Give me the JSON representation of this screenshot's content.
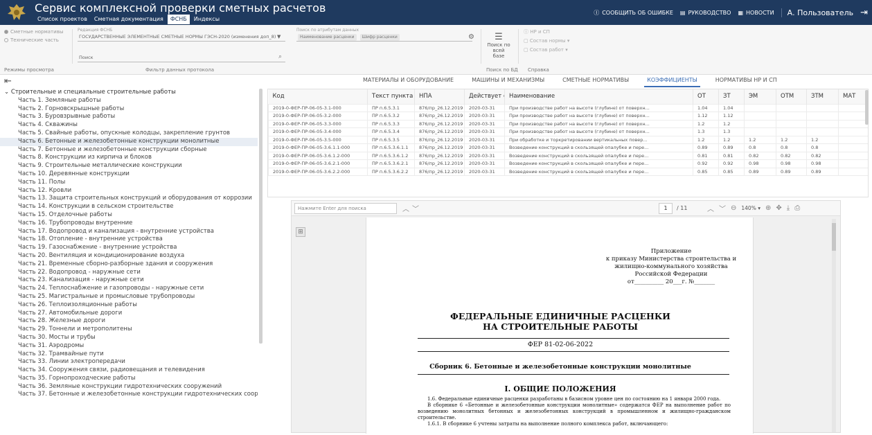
{
  "header": {
    "app_title": "Сервис комплексной проверки сметных расчетов",
    "tabs": [
      {
        "label": "Список проектов"
      },
      {
        "label": "Сметная документация"
      },
      {
        "label": "ФСНБ"
      },
      {
        "label": "Индексы"
      }
    ],
    "active_tab": "ФСНБ",
    "report_error": "Сообщить об ошибке",
    "guide": "Руководство",
    "news": "Новости",
    "user": "А. Пользователь"
  },
  "toolbar": {
    "mode_radio_1": "Сметные нормативы",
    "mode_radio_2": "Технические часть",
    "view_modes_caption": "Режимы просмотра",
    "edition_label": "Редакция ФСНБ",
    "edition_value": "ГОСУДАРСТВЕННЫЕ ЭЛЕМЕНТНЫЕ СМЕТНЫЕ НОРМЫ ГЭСН-2020 (изменения доп_8)",
    "search_placeholder": "Поиск",
    "protocol_search_label": "Поиск по атрибутам данных",
    "chip_1": "Наименование расценки",
    "chip_2": "Шифр расценки",
    "filter_caption": "Фильтр данных протокола",
    "db_search_line1": "Поиск по всей",
    "db_search_line2": "базе",
    "db_search_caption": "Поиск по БД",
    "help_item_1": "НР и СП",
    "help_item_2": "Состав нормы",
    "help_item_3": "Состав работ",
    "help_caption": "Справка"
  },
  "content_tabs": [
    {
      "label": "МАТЕРИАЛЫ И ОБОРУДОВАНИЕ"
    },
    {
      "label": "МАШИНЫ И МЕХАНИЗМЫ"
    },
    {
      "label": "СМЕТНЫЕ НОРМАТИВЫ"
    },
    {
      "label": "КОЭФФИЦИЕНТЫ"
    },
    {
      "label": "НОРМАТИВЫ НР И СП"
    }
  ],
  "active_content_tab": "КОЭФФИЦИЕНТЫ",
  "tree": {
    "root": "Строительные и специальные строительные работы",
    "items": [
      "Часть 1. Земляные работы",
      "Часть 2. Горновскрышные работы",
      "Часть 3. Буровзрывные работы",
      "Часть 4. Скважины",
      "Часть 5. Свайные работы, опускные колодцы, закрепление грунтов",
      "Часть 6. Бетонные и железобетонные конструкции монолитные",
      "Часть 7. Бетонные и железобетонные конструкции сборные",
      "Часть 8. Конструкции из кирпича и блоков",
      "Часть 9. Строительные металлические конструкции",
      "Часть 10. Деревянные конструкции",
      "Часть 11. Полы",
      "Часть 12. Кровли",
      "Часть 13. Защита строительных конструкций и оборудования от коррозии",
      "Часть 14. Конструкции в сельском строительстве",
      "Часть 15. Отделочные работы",
      "Часть 16. Трубопроводы внутренние",
      "Часть 17. Водопровод и канализация - внутренние устройства",
      "Часть 18. Отопление - внутренние устройства",
      "Часть 19. Газоснабжение - внутренние устройства",
      "Часть 20. Вентиляция и кондиционирование воздуха",
      "Часть 21. Временные сборно-разборные здания и сооружения",
      "Часть 22. Водопровод - наружные сети",
      "Часть 23. Канализация - наружные сети",
      "Часть 24. Теплоснабжение и газопроводы - наружные сети",
      "Часть 25. Магистральные и промысловые трубопроводы",
      "Часть 26. Теплоизоляционные работы",
      "Часть 27. Автомобильные дороги",
      "Часть 28. Железные дороги",
      "Часть 29. Тоннели и метрополитены",
      "Часть 30. Мосты и трубы",
      "Часть 31. Аэродромы",
      "Часть 32. Трамвайные пути",
      "Часть 33. Линии электропередачи",
      "Часть 34. Сооружения связи, радиовещания и телевидения",
      "Часть 35. Горнопроходческие работы",
      "Часть 36. Земляные конструкции гидротехнических сооружений",
      "Часть 37. Бетонные и железобетонные конструкции гидротехнических сооруже..."
    ],
    "selected_index": 5
  },
  "table": {
    "columns": [
      "Код",
      "Текст пункта",
      "НПА",
      "Действует с",
      "Наименование",
      "ОТ",
      "ЗТ",
      "ЭМ",
      "ОТМ",
      "ЗТМ",
      "МАТ"
    ],
    "rows": [
      [
        "2019-0-ФЕР-ПР-06-05-3.1-000",
        "ПР п.6.5.3.1",
        "876/пр_26.12.2019",
        "2020-03-31",
        "При производстве работ на высоте (глубине) от поверхн...",
        "1.04",
        "1.04",
        "",
        "",
        "",
        ""
      ],
      [
        "2019-0-ФЕР-ПР-06-05-3.2-000",
        "ПР п.6.5.3.2",
        "876/пр_26.12.2019",
        "2020-03-31",
        "При производстве работ на высоте (глубине) от поверхн...",
        "1.12",
        "1.12",
        "",
        "",
        "",
        ""
      ],
      [
        "2019-0-ФЕР-ПР-06-05-3.3-000",
        "ПР п.6.5.3.3",
        "876/пр_26.12.2019",
        "2020-03-31",
        "При производстве работ на высоте (глубине) от поверхн...",
        "1.2",
        "1.2",
        "",
        "",
        "",
        ""
      ],
      [
        "2019-0-ФЕР-ПР-06-05-3.4-000",
        "ПР п.6.5.3.4",
        "876/пр_26.12.2019",
        "2020-03-31",
        "При производстве работ на высоте (глубине) от поверхн...",
        "1.3",
        "1.3",
        "",
        "",
        "",
        ""
      ],
      [
        "2019-0-ФЕР-ПР-06-05-3.5-000",
        "ПР п.6.5.3.5",
        "876/пр_26.12.2019",
        "2020-03-31",
        "При обработке и торкретировании вертикальных повер...",
        "1.2",
        "1.2",
        "1.2",
        "1.2",
        "1.2",
        ""
      ],
      [
        "2019-0-ФЕР-ПР-06-05-3.6.1.1-000",
        "ПР п.6.5.3.6.1.1",
        "876/пр_26.12.2019",
        "2020-03-31",
        "Возведение конструкций в скользящей опалубке и пере...",
        "0.89",
        "0.89",
        "0.8",
        "0.8",
        "0.8",
        ""
      ],
      [
        "2019-0-ФЕР-ПР-06-05-3.6.1.2-000",
        "ПР п.6.5.3.6.1.2",
        "876/пр_26.12.2019",
        "2020-03-31",
        "Возведение конструкций в скользящей опалубке и пере...",
        "0.81",
        "0.81",
        "0.82",
        "0.82",
        "0.82",
        ""
      ],
      [
        "2019-0-ФЕР-ПР-06-05-3.6.2.1-000",
        "ПР п.6.5.3.6.2.1",
        "876/пр_26.12.2019",
        "2020-03-31",
        "Возведение конструкций в скользящей опалубке и пере...",
        "0.92",
        "0.92",
        "0.98",
        "0.98",
        "0.98",
        ""
      ],
      [
        "2019-0-ФЕР-ПР-06-05-3.6.2.2-000",
        "ПР п.6.5.3.6.2.2",
        "876/пр_26.12.2019",
        "2020-03-31",
        "Возведение конструкций в скользящей опалубке и пере...",
        "0.85",
        "0.85",
        "0.89",
        "0.89",
        "0.89",
        ""
      ]
    ]
  },
  "viewer": {
    "search_placeholder": "Нажмите Enter для поиска",
    "page": "1",
    "page_count": "/ 11",
    "zoom": "140% ▾"
  },
  "document": {
    "app_line1": "Приложение",
    "app_line2": "к приказу Министерства строительства и",
    "app_line3": "жилищно-коммунального хозяйства",
    "app_line4": "Российской Федерации",
    "app_line5": "от__________ 20___г. №_______",
    "title_line1": "ФЕДЕРАЛЬНЫЕ ЕДИНИЧНЫЕ РАСЦЕНКИ",
    "title_line2": "НА СТРОИТЕЛЬНЫЕ РАБОТЫ",
    "code": "ФЕР 81-02-06-2022",
    "collection": "Сборник 6. Бетонные и железобетонные конструкции монолитные",
    "section": "I. ОБЩИЕ ПОЛОЖЕНИЯ",
    "para1": "1.6. Федеральные единичные расценки разработаны в базисном уровне цен по состоянию на 1 января 2000 года.",
    "para2": "В сборнике 6 «Бетонные и железобетонные конструкции монолитные» содержатся ФЕР на выполнение работ по возведению монолитных бетонных и железобетонных конструкций в промышленном и жилищно-гражданском строительстве.",
    "para3": "1.6.1. В сборнике 6 учтены затраты на выполнение полного комплекса работ, включающего:"
  }
}
